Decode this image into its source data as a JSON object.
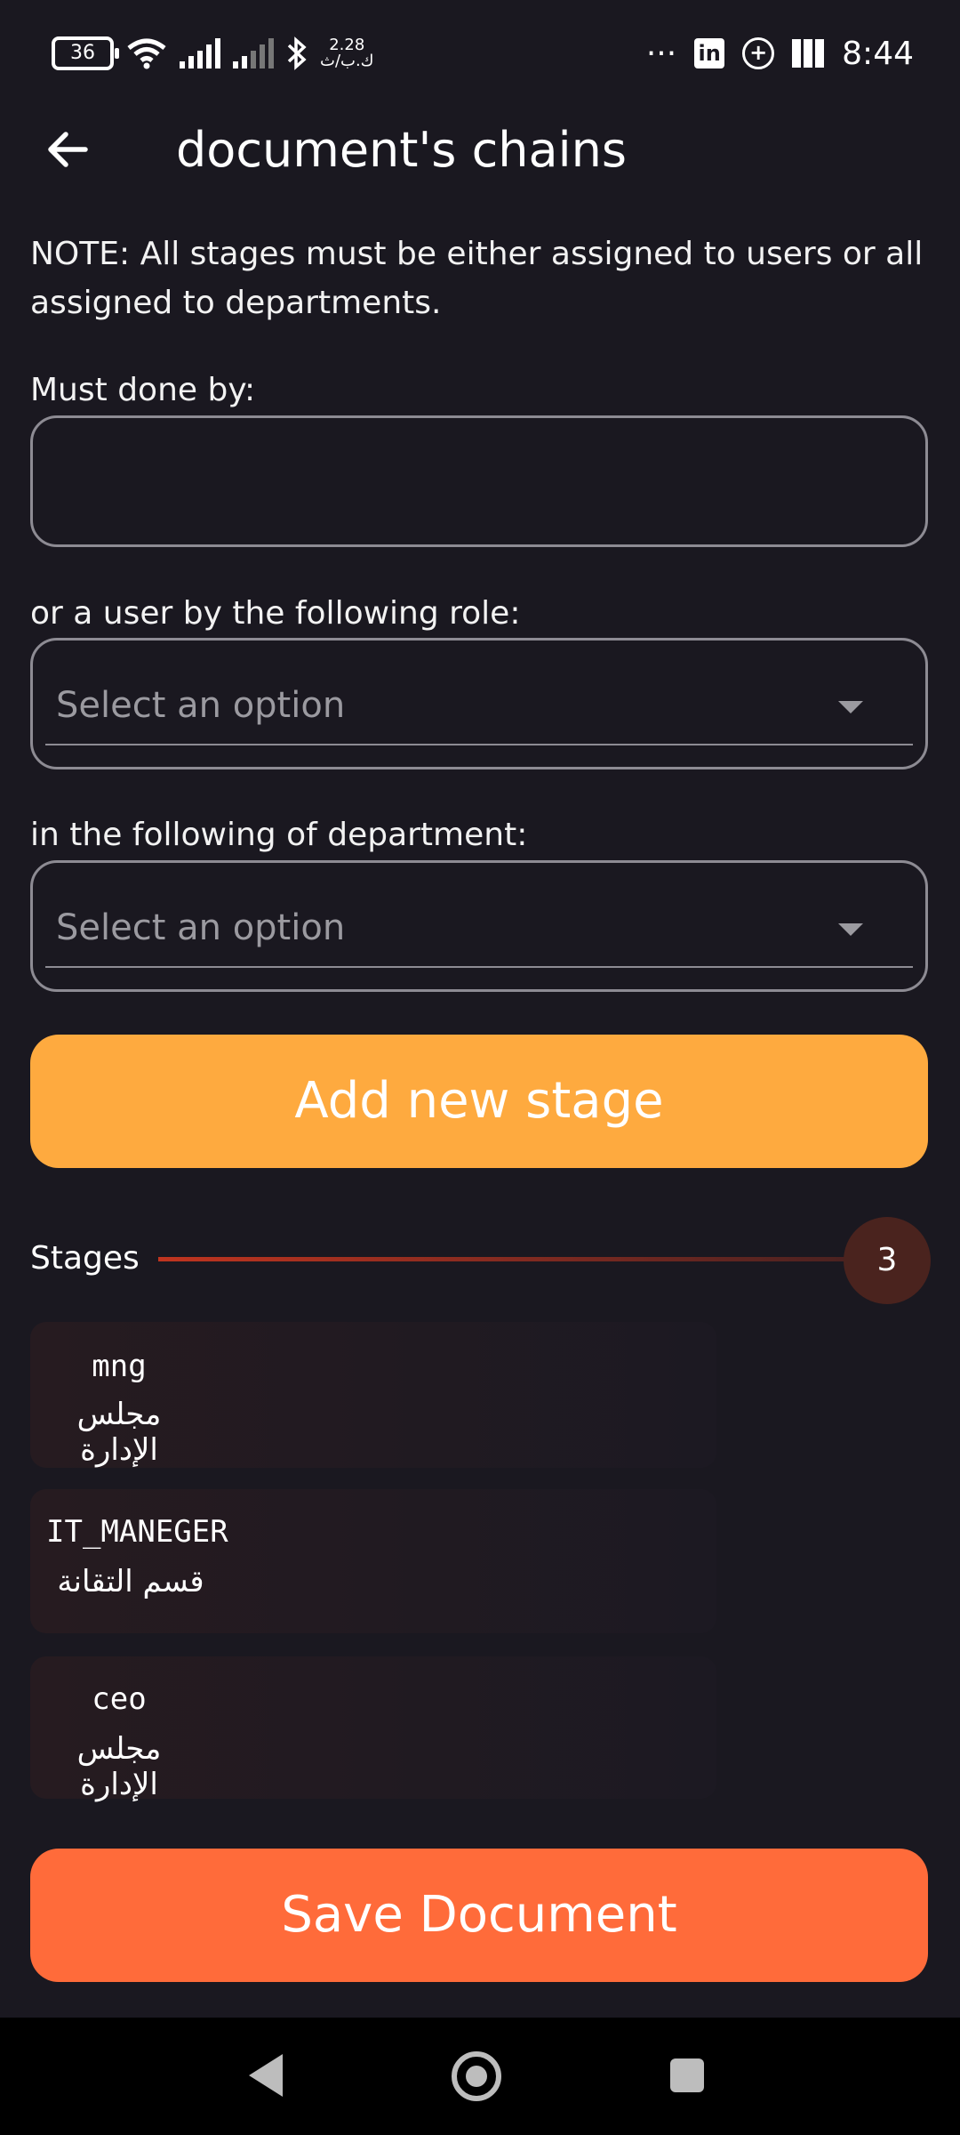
{
  "status_bar": {
    "battery": "36",
    "speed_value": "2.28",
    "speed_unit": "ك.ب/ث",
    "time": "8:44",
    "more": "···"
  },
  "app_bar": {
    "title": "document's chains"
  },
  "note": "NOTE: All stages must be either assigned to users or all assigned to departments.",
  "form": {
    "must_done_by_label": "Must done by:",
    "must_done_by_value": "",
    "role_label": "or a user by the following role:",
    "role_placeholder": "Select an option",
    "department_label": "in the following of department:",
    "department_placeholder": "Select an option"
  },
  "add_stage_label": "Add new stage",
  "stages": {
    "label": "Stages",
    "count": "3",
    "items": [
      {
        "name": "mng",
        "department": "مجلس الإدارة"
      },
      {
        "name": "IT_MANEGER",
        "department": "قسم التقانة"
      },
      {
        "name": "ceo",
        "department": "مجلس الإدارة"
      }
    ]
  },
  "save_label": "Save Document",
  "icons": {
    "back": "arrow-left-icon",
    "dropdown": "caret-down-icon"
  },
  "colors": {
    "background": "#1a1820",
    "add_button": "#feaa3f",
    "save_button": "#ff6b3a",
    "badge": "#4a231e"
  }
}
